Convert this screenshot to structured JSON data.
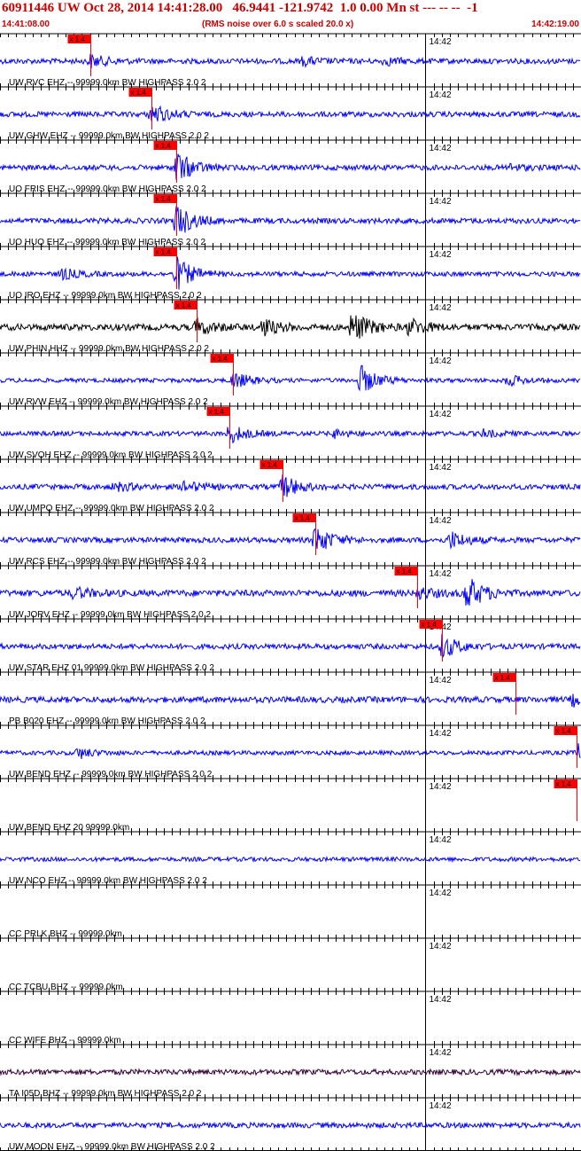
{
  "header": {
    "title": "60911446 UW Oct 28, 2014 14:41:28.00   46.9441 -121.9742  1.0 0.00 Mn st --- -- --  -1",
    "start_time": "14:41:08.00",
    "rms_note": "(RMS noise over 6.0 s scaled 20.0 x)",
    "end_time": "14:42:19.00"
  },
  "colors": {
    "trace": "#0000ff",
    "trace_phin": "#000000",
    "trace_ta": "#330033",
    "pick": "#ff0000",
    "header": "#cc0000"
  },
  "chart_data": {
    "type": "line",
    "title": "60911446 UW Oct 28, 2014 14:41:28.00   46.9441 -121.9742  1.0 0.00 Mn st --- -- --  -1",
    "x_range": [
      "14:41:08.00",
      "14:42:19.00"
    ],
    "minute_mark": "14:42",
    "grid": "vertical ticks every second",
    "series": [
      {
        "name": "UW RVC EHZ -- 99999.0km BW  HIGHPASS  2.0  2",
        "pick_label": "x 1.4",
        "pick_time_s": 11.0,
        "noise": 0.25,
        "events": [
          [
            11.0,
            0.6
          ],
          [
            37.0,
            0.35
          ],
          [
            47.0,
            0.3
          ]
        ],
        "color_key": "trace"
      },
      {
        "name": "UW GHW EHZ -- 99999.0km BW  HIGHPASS  2.0  2",
        "pick_label": "x 1.4",
        "pick_time_s": 18.5,
        "noise": 0.25,
        "events": [
          [
            18.5,
            1.0
          ]
        ],
        "color_key": "trace"
      },
      {
        "name": "UO FRIS EHZ -- 99999.0km BW  HIGHPASS  2.0  2",
        "pick_label": "x 1.4",
        "pick_time_s": 21.5,
        "noise": 0.25,
        "events": [
          [
            21.5,
            1.6
          ],
          [
            62.0,
            0.3
          ]
        ],
        "color_key": "trace"
      },
      {
        "name": "UO HUQ EHZ -- 99999.0km BW  HIGHPASS  2.0  2",
        "pick_label": "x 1.4",
        "pick_time_s": 21.5,
        "noise": 0.25,
        "events": [
          [
            21.5,
            1.6
          ]
        ],
        "color_key": "trace"
      },
      {
        "name": "UO IRO EHZ -- 99999.0km BW  HIGHPASS  2.0  2",
        "pick_label": "x 1.4",
        "pick_time_s": 21.5,
        "noise": 0.22,
        "events": [
          [
            7.5,
            0.5
          ],
          [
            21.5,
            1.6
          ]
        ],
        "color_key": "trace"
      },
      {
        "name": "UW PHIN HHZ -- 99999.0km BW  HIGHPASS  2.0  2",
        "pick_label": "x 1.4",
        "pick_time_s": 24.0,
        "noise": 0.3,
        "events": [
          [
            24.0,
            0.7
          ],
          [
            32.0,
            0.8
          ],
          [
            43.0,
            1.5
          ],
          [
            50.0,
            0.8
          ]
        ],
        "color_key": "trace_phin"
      },
      {
        "name": "UW RVW EHZ -- 99999.0km BW  HIGHPASS  2.0  2",
        "pick_label": "x 1.4",
        "pick_time_s": 28.5,
        "noise": 0.2,
        "events": [
          [
            28.5,
            0.8
          ],
          [
            44.0,
            1.4
          ],
          [
            62.0,
            0.5
          ]
        ],
        "color_key": "trace"
      },
      {
        "name": "UW SVOH EHZ -- 99999.0km BW  HIGHPASS  2.0  2",
        "pick_label": "x 1.4",
        "pick_time_s": 28.0,
        "noise": 0.22,
        "events": [
          [
            28.0,
            0.9
          ],
          [
            40.5,
            0.4
          ],
          [
            59.0,
            0.3
          ]
        ],
        "color_key": "trace"
      },
      {
        "name": "UW UMPQ EHZ -- 99999.0km BW  HIGHPASS  2.0  2",
        "pick_label": "x 1.4",
        "pick_time_s": 34.5,
        "noise": 0.25,
        "events": [
          [
            14.0,
            0.4
          ],
          [
            22.5,
            0.5
          ],
          [
            34.5,
            1.1
          ]
        ],
        "color_key": "trace"
      },
      {
        "name": "UW RCS EHZ -- 99999.0km BW  HIGHPASS  2.0  2",
        "pick_label": "x 1.4",
        "pick_time_s": 38.5,
        "noise": 0.25,
        "events": [
          [
            38.5,
            1.4
          ],
          [
            55.0,
            0.8
          ]
        ],
        "color_key": "trace"
      },
      {
        "name": "UW JORV EHZ -- 99999.0km BW  HIGHPASS  2.0  2",
        "pick_label": "x 1.4",
        "pick_time_s": 51.0,
        "noise": 0.3,
        "events": [
          [
            9.0,
            0.5
          ],
          [
            51.0,
            0.5
          ],
          [
            57.0,
            1.6
          ]
        ],
        "color_key": "trace"
      },
      {
        "name": "UW STAR EHZ 01 99999.0km BW  HIGHPASS  2.0  2",
        "pick_label": "x 1.4",
        "pick_time_s": 54.0,
        "noise": 0.25,
        "events": [
          [
            54.0,
            1.1
          ]
        ],
        "color_key": "trace"
      },
      {
        "name": "PB B020 EHZ -- 99999.0km BW  HIGHPASS  2.0  2",
        "pick_label": "x 1.4",
        "pick_time_s": 63.0,
        "noise": 0.28,
        "events": [
          [
            70.0,
            0.5
          ]
        ],
        "color_key": "trace"
      },
      {
        "name": "UW BEND EHZ -- 99999.0km BW  HIGHPASS  2.0  2",
        "pick_label": "x 1.4",
        "pick_time_s": 70.5,
        "noise": 0.2,
        "events": [
          [
            9.5,
            0.5
          ],
          [
            70.5,
            0.9
          ]
        ],
        "color_key": "trace"
      },
      {
        "name": "UW BEND EHZ 20 99999.0km",
        "pick_label": "x 1.4",
        "pick_time_s": 70.5,
        "noise": 0,
        "events": [],
        "color_key": "trace"
      },
      {
        "name": "UW NCO EHZ -- 99999.0km BW  HIGHPASS  2.0  2",
        "pick_label": "x 1.4",
        "pick_time_s": 76.5,
        "noise": 0.2,
        "events": [
          [
            76.0,
            0.9
          ]
        ],
        "color_key": "trace"
      },
      {
        "name": "CC PRLK BHZ -- 99999.0km",
        "pick_label": "",
        "pick_time_s": null,
        "noise": 0,
        "events": [],
        "color_key": "trace"
      },
      {
        "name": "CC TCBU BHZ -- 99999.0km",
        "pick_label": "",
        "pick_time_s": null,
        "noise": 0,
        "events": [],
        "color_key": "trace"
      },
      {
        "name": "CC WIFE BHZ -- 99999.0km",
        "pick_label": "",
        "pick_time_s": null,
        "noise": 0,
        "events": [],
        "color_key": "trace"
      },
      {
        "name": "TA I05D BHZ -- 99999.0km BW  HIGHPASS  2.0  2",
        "pick_label": "",
        "pick_time_s": null,
        "noise": 0.25,
        "events": [],
        "color_key": "trace_ta"
      },
      {
        "name": "UW MOON EHZ -- 99999.0km BW  HIGHPASS  2.0  2",
        "pick_label": "",
        "pick_time_s": null,
        "noise": 0.25,
        "events": [],
        "color_key": "trace"
      }
    ]
  }
}
